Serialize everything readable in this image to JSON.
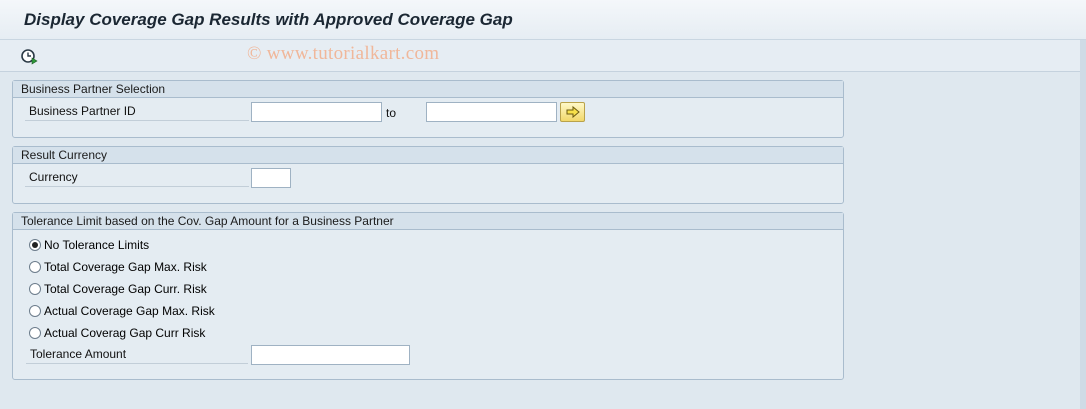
{
  "page_title": "Display Coverage Gap Results with Approved Coverage Gap",
  "watermark": "© www.tutorialkart.com",
  "toolbar": {
    "execute_icon": "execute-clock-icon"
  },
  "groups": {
    "business_partner": {
      "title": "Business Partner Selection",
      "field_label": "Business Partner ID",
      "from_value": "",
      "to_label": "to",
      "to_value": "",
      "multi_select_icon": "arrow-right-icon"
    },
    "result_currency": {
      "title": "Result Currency",
      "field_label": "Currency",
      "value": ""
    },
    "tolerance": {
      "title": "Tolerance Limit  based on the Cov. Gap Amount for a  Business Partner",
      "options": [
        {
          "label": "No Tolerance Limits",
          "selected": true
        },
        {
          "label": "Total Coverage Gap Max. Risk",
          "selected": false
        },
        {
          "label": "Total Coverage Gap Curr. Risk",
          "selected": false
        },
        {
          "label": "Actual Coverage Gap Max. Risk",
          "selected": false
        },
        {
          "label": "Actual Coverag Gap Curr Risk",
          "selected": false
        }
      ],
      "amount_label": "Tolerance Amount",
      "amount_value": ""
    }
  }
}
